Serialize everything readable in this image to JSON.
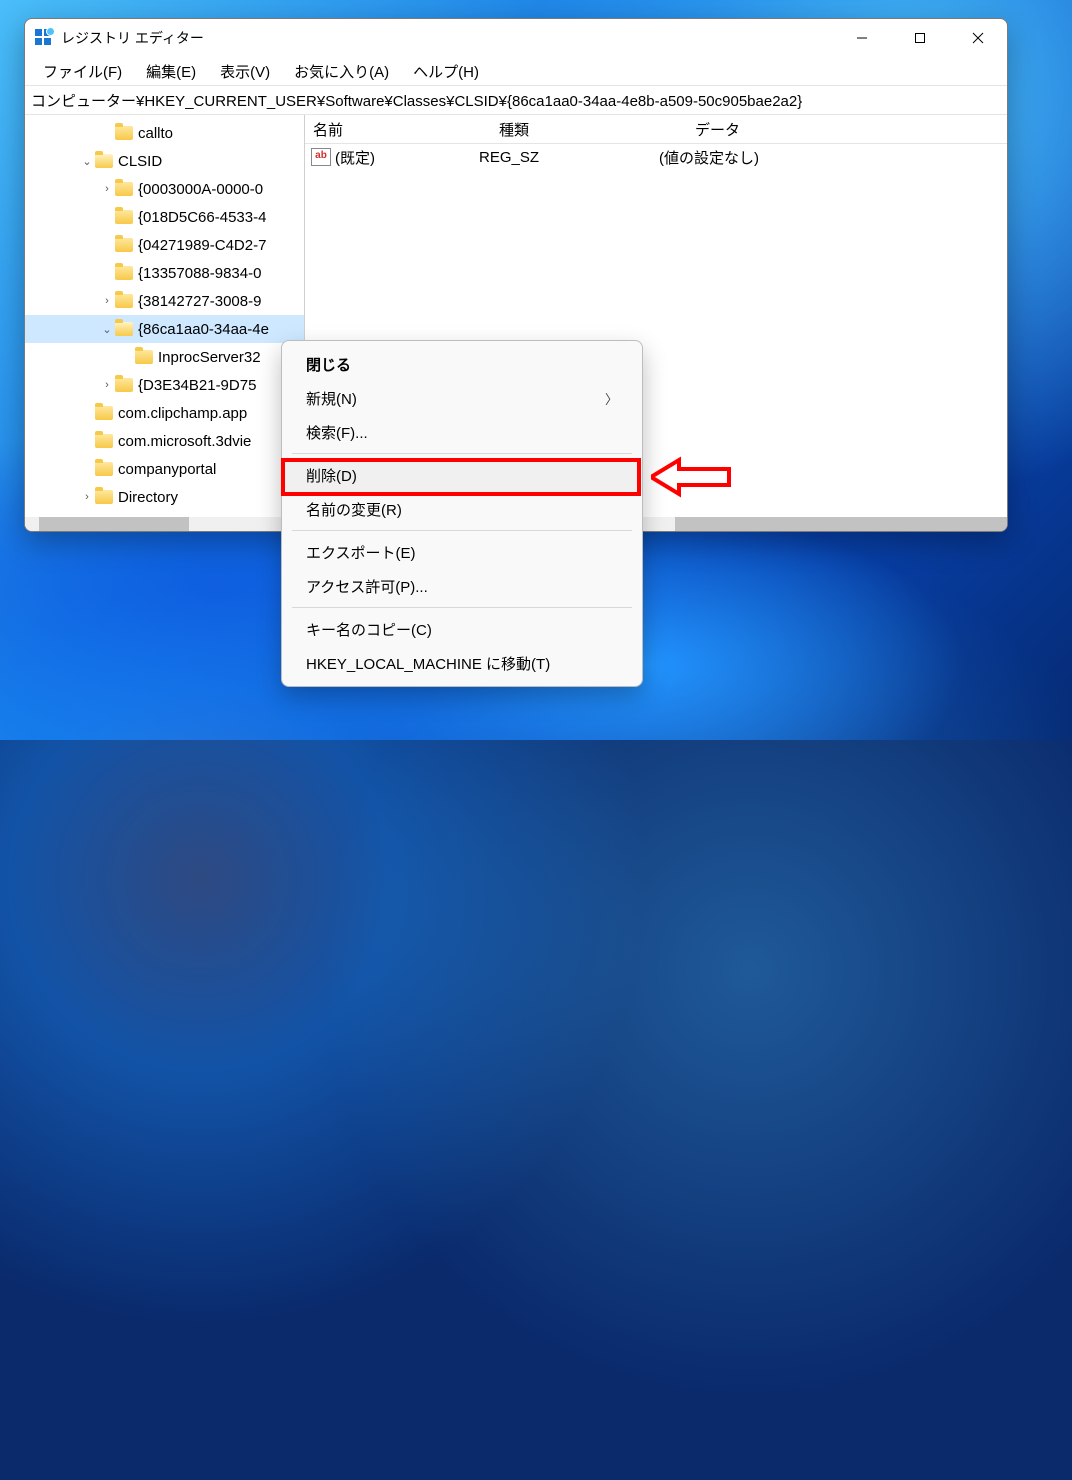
{
  "window": {
    "title": "レジストリ エディター"
  },
  "menu": {
    "file": "ファイル(F)",
    "edit": "編集(E)",
    "view": "表示(V)",
    "favorites": "お気に入り(A)",
    "help": "ヘルプ(H)"
  },
  "address": "コンピューター¥HKEY_CURRENT_USER¥Software¥Classes¥CLSID¥{86ca1aa0-34aa-4e8b-a509-50c905bae2a2}",
  "tree": {
    "items": [
      {
        "indent": 2,
        "tw": "",
        "label": "callto"
      },
      {
        "indent": 1,
        "tw": "v",
        "label": "CLSID",
        "open": true
      },
      {
        "indent": 2,
        "tw": ">",
        "label": "{0003000A-0000-0"
      },
      {
        "indent": 2,
        "tw": "",
        "label": "{018D5C66-4533-4"
      },
      {
        "indent": 2,
        "tw": "",
        "label": "{04271989-C4D2-7"
      },
      {
        "indent": 2,
        "tw": "",
        "label": "{13357088-9834-0"
      },
      {
        "indent": 2,
        "tw": ">",
        "label": "{38142727-3008-9"
      },
      {
        "indent": 2,
        "tw": "v",
        "label": "{86ca1aa0-34aa-4e",
        "open": true,
        "selected": true
      },
      {
        "indent": 3,
        "tw": "",
        "label": "InprocServer32"
      },
      {
        "indent": 2,
        "tw": ">",
        "label": "{D3E34B21-9D75"
      },
      {
        "indent": 1,
        "tw": "",
        "label": "com.clipchamp.app"
      },
      {
        "indent": 1,
        "tw": "",
        "label": "com.microsoft.3dvie"
      },
      {
        "indent": 1,
        "tw": "",
        "label": "companyportal"
      },
      {
        "indent": 1,
        "tw": ">",
        "label": "Directory"
      }
    ]
  },
  "list": {
    "head": {
      "name": "名前",
      "type": "種類",
      "data": "データ"
    },
    "rows": [
      {
        "name": "(既定)",
        "type": "REG_SZ",
        "data": "(値の設定なし)"
      }
    ]
  },
  "ctx": {
    "close": "閉じる",
    "new": "新規(N)",
    "find": "検索(F)...",
    "delete": "削除(D)",
    "rename": "名前の変更(R)",
    "export": "エクスポート(E)",
    "permissions": "アクセス許可(P)...",
    "copykey": "キー名のコピー(C)",
    "gotohklm": "HKEY_LOCAL_MACHINE に移動(T)"
  },
  "annotation": {
    "color": "#ff0000"
  }
}
